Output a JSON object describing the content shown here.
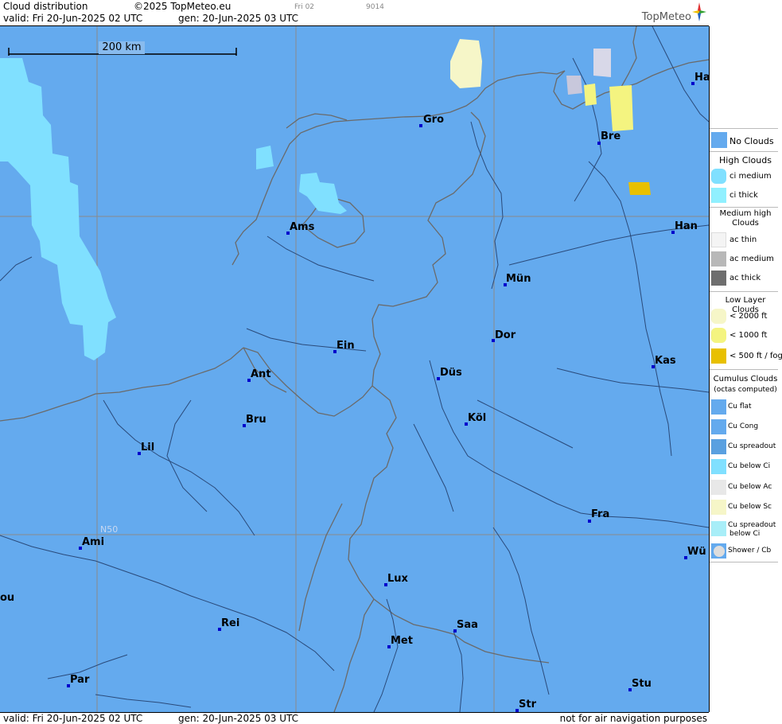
{
  "header": {
    "title": "Cloud distribution",
    "copyright": "©2025 TopMeteo.eu",
    "valid": "valid:  Fri  20-Jun-2025  02 UTC",
    "gen": "gen: 20-Jun-2025 03 UTC",
    "tiny_left": "Fri 02",
    "tiny_right": "9014",
    "logo": "TopMeteo"
  },
  "footer": {
    "valid": "valid:  Fri  20-Jun-2025  02 UTC",
    "gen": "gen: 20-Jun-2025 03 UTC",
    "disclaimer": "not for air navigation purposes"
  },
  "map": {
    "scale_label": "200 km",
    "lat_label": "N50",
    "cities": [
      "Ha",
      "Gro",
      "Bre",
      "Ams",
      "Han",
      "Mün",
      "Ein",
      "Dor",
      "Ant",
      "Düs",
      "Kas",
      "Köl",
      "Bru",
      "Lil",
      "Fra",
      "Ami",
      "Wü",
      "Lux",
      "ou",
      "Rei",
      "Saa",
      "Met",
      "Par",
      "Stu",
      "Str"
    ]
  },
  "legend": {
    "no_clouds": "No Clouds",
    "high_title": "High Clouds",
    "ci_medium": "ci medium",
    "ci_thick": "ci thick",
    "medium_title": "Medium high Clouds",
    "ac_thin": "ac thin",
    "ac_medium": "ac medium",
    "ac_thick": "ac thick",
    "low_title": "Low Layer Clouds",
    "low_2000": "< 2000 ft",
    "low_1000": "< 1000 ft",
    "low_500": "< 500 ft / fog",
    "cu_title": "Cumulus Clouds",
    "cu_subtitle": "(octas computed)",
    "cu_flat": "Cu flat",
    "cu_cong": "Cu Cong",
    "cu_spreadout": "Cu spreadout",
    "cu_below_ci": "Cu below Ci",
    "cu_below_ac": "Cu below Ac",
    "cu_below_sc": "Cu below Sc",
    "cu_spreadout_below_ci_1": "Cu spreadout",
    "cu_spreadout_below_ci_2": "below Ci",
    "shower": "Shower / Cb"
  },
  "colors": {
    "no_clouds": "#64aaee",
    "ci_medium": "#80e0ff",
    "ci_thick": "#90f0ff",
    "low_2000": "#f6f6c8",
    "low_1000": "#f4f480",
    "low_500": "#e8c000",
    "border": "#6a6a6a",
    "river": "#2a4a7a"
  }
}
